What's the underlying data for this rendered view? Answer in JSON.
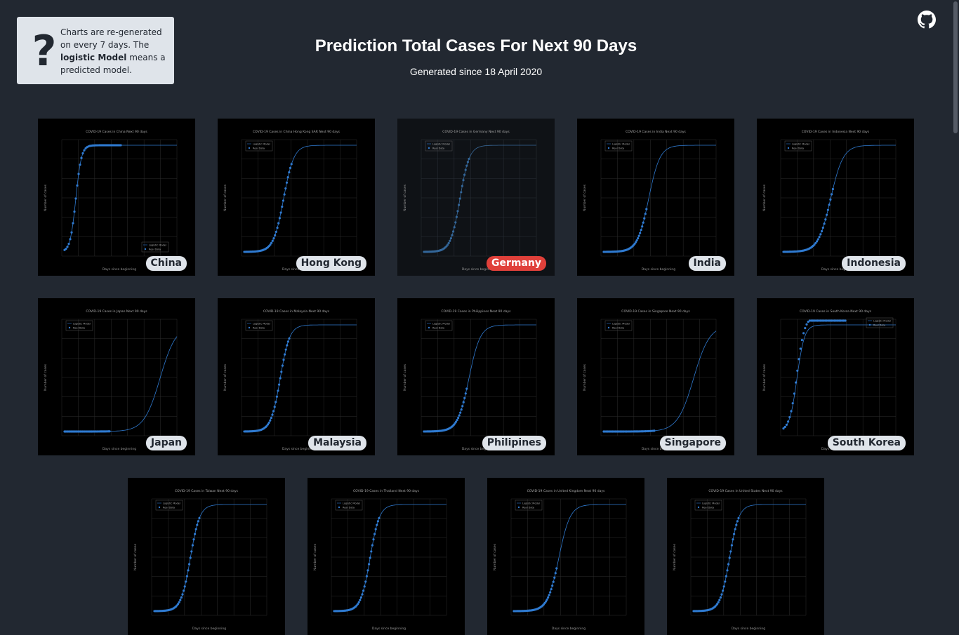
{
  "help": {
    "text_before": "Charts are re-generated on every 7 days. The ",
    "bold_text": "logistic Model",
    "text_after": " means a predicted model."
  },
  "header": {
    "title": "Prediction Total Cases For Next 90 Days",
    "subtitle": "Generated since 18 April 2020"
  },
  "colors": {
    "background": "#222831",
    "active_label": "#e0403a",
    "label_bg": "#dfe4ea",
    "series": "#2f7ad0"
  },
  "countries": [
    {
      "name": "China",
      "title": "COVID-19 Cases in China Next 90 days",
      "active": false,
      "curve": "fast",
      "legend": "bottom"
    },
    {
      "name": "Hong Kong",
      "title": "COVID-19 Cases in China Hong Kong SAR Next 90 days",
      "active": false,
      "curve": "late",
      "legend": "top"
    },
    {
      "name": "Germany",
      "title": "COVID-19 Cases in Germany Next 90 days",
      "active": true,
      "curve": "mid",
      "legend": "top"
    },
    {
      "name": "India",
      "title": "COVID-19 Cases in India Next 90 days",
      "active": false,
      "curve": "mid2",
      "legend": "top"
    },
    {
      "name": "Indonesia",
      "title": "COVID-19 Cases in Indonesia Next 90 days",
      "active": false,
      "curve": "mid3",
      "legend": "top"
    },
    {
      "name": "Japan",
      "title": "COVID-19 Cases in Japan Next 90 days",
      "active": false,
      "curve": "far",
      "legend": "top"
    },
    {
      "name": "Malaysia",
      "title": "COVID-19 Cases in Malaysia Next 90 days",
      "active": false,
      "curve": "mid",
      "legend": "top"
    },
    {
      "name": "Philipines",
      "title": "COVID-19 Cases in Philippines Next 90 days",
      "active": false,
      "curve": "mid2",
      "legend": "top"
    },
    {
      "name": "Singapore",
      "title": "COVID-19 Cases in Singapore Next 90 days",
      "active": false,
      "curve": "far2",
      "legend": "top"
    },
    {
      "name": "South Korea",
      "title": "COVID-19 Cases in South Korea Next 90 days",
      "active": false,
      "curve": "korea",
      "legend": "top-right"
    },
    {
      "name": "Taiwan",
      "title": "COVID-19 Cases in Taiwan Next 90 days",
      "active": false,
      "curve": "mid",
      "legend": "top"
    },
    {
      "name": "Thailand",
      "title": "COVID-19 Cases in Thailand Next 90 days",
      "active": false,
      "curve": "mid",
      "legend": "top"
    },
    {
      "name": "United Kingdom",
      "title": "COVID-19 Cases in United Kingdom Next 90 days",
      "active": false,
      "curve": "mid2",
      "legend": "top"
    },
    {
      "name": "United States",
      "title": "COVID-19 Cases in United States Next 90 days",
      "active": false,
      "curve": "mid",
      "legend": "top"
    }
  ],
  "legend": {
    "model": "Logistic Model",
    "real": "Real Data"
  },
  "axis": {
    "xlabel": "Days since beginning",
    "ylabel": "Number of cases"
  },
  "icons": {
    "help": "question-mark-icon",
    "github": "github-icon"
  }
}
